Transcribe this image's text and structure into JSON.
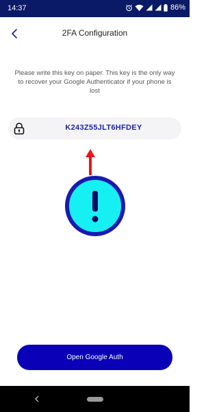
{
  "status_bar": {
    "time": "14:37",
    "battery_percent": "86%",
    "icons": [
      "alarm-icon",
      "wifi-icon",
      "signal-icon",
      "signal-icon",
      "battery-icon"
    ]
  },
  "header": {
    "title": "2FA Configuration",
    "back_icon": "chevron-left-icon"
  },
  "instructions": {
    "text": "Please write this key on paper. This key is the only way to recover your Google Authenticator if your phone is lost"
  },
  "key_field": {
    "icon": "lock-icon",
    "value": "K243Z55JLT6HFDEY"
  },
  "annotation": {
    "arrow_color": "#e8151b",
    "circle_fill": "#16f0f2",
    "circle_border": "#1a1ab0",
    "symbol": "!"
  },
  "actions": {
    "open_button_label": "Open Google Auth"
  },
  "colors": {
    "status_bar": "#0b1a66",
    "primary_button": "#0a00b8",
    "key_text": "#1f1fa8"
  }
}
